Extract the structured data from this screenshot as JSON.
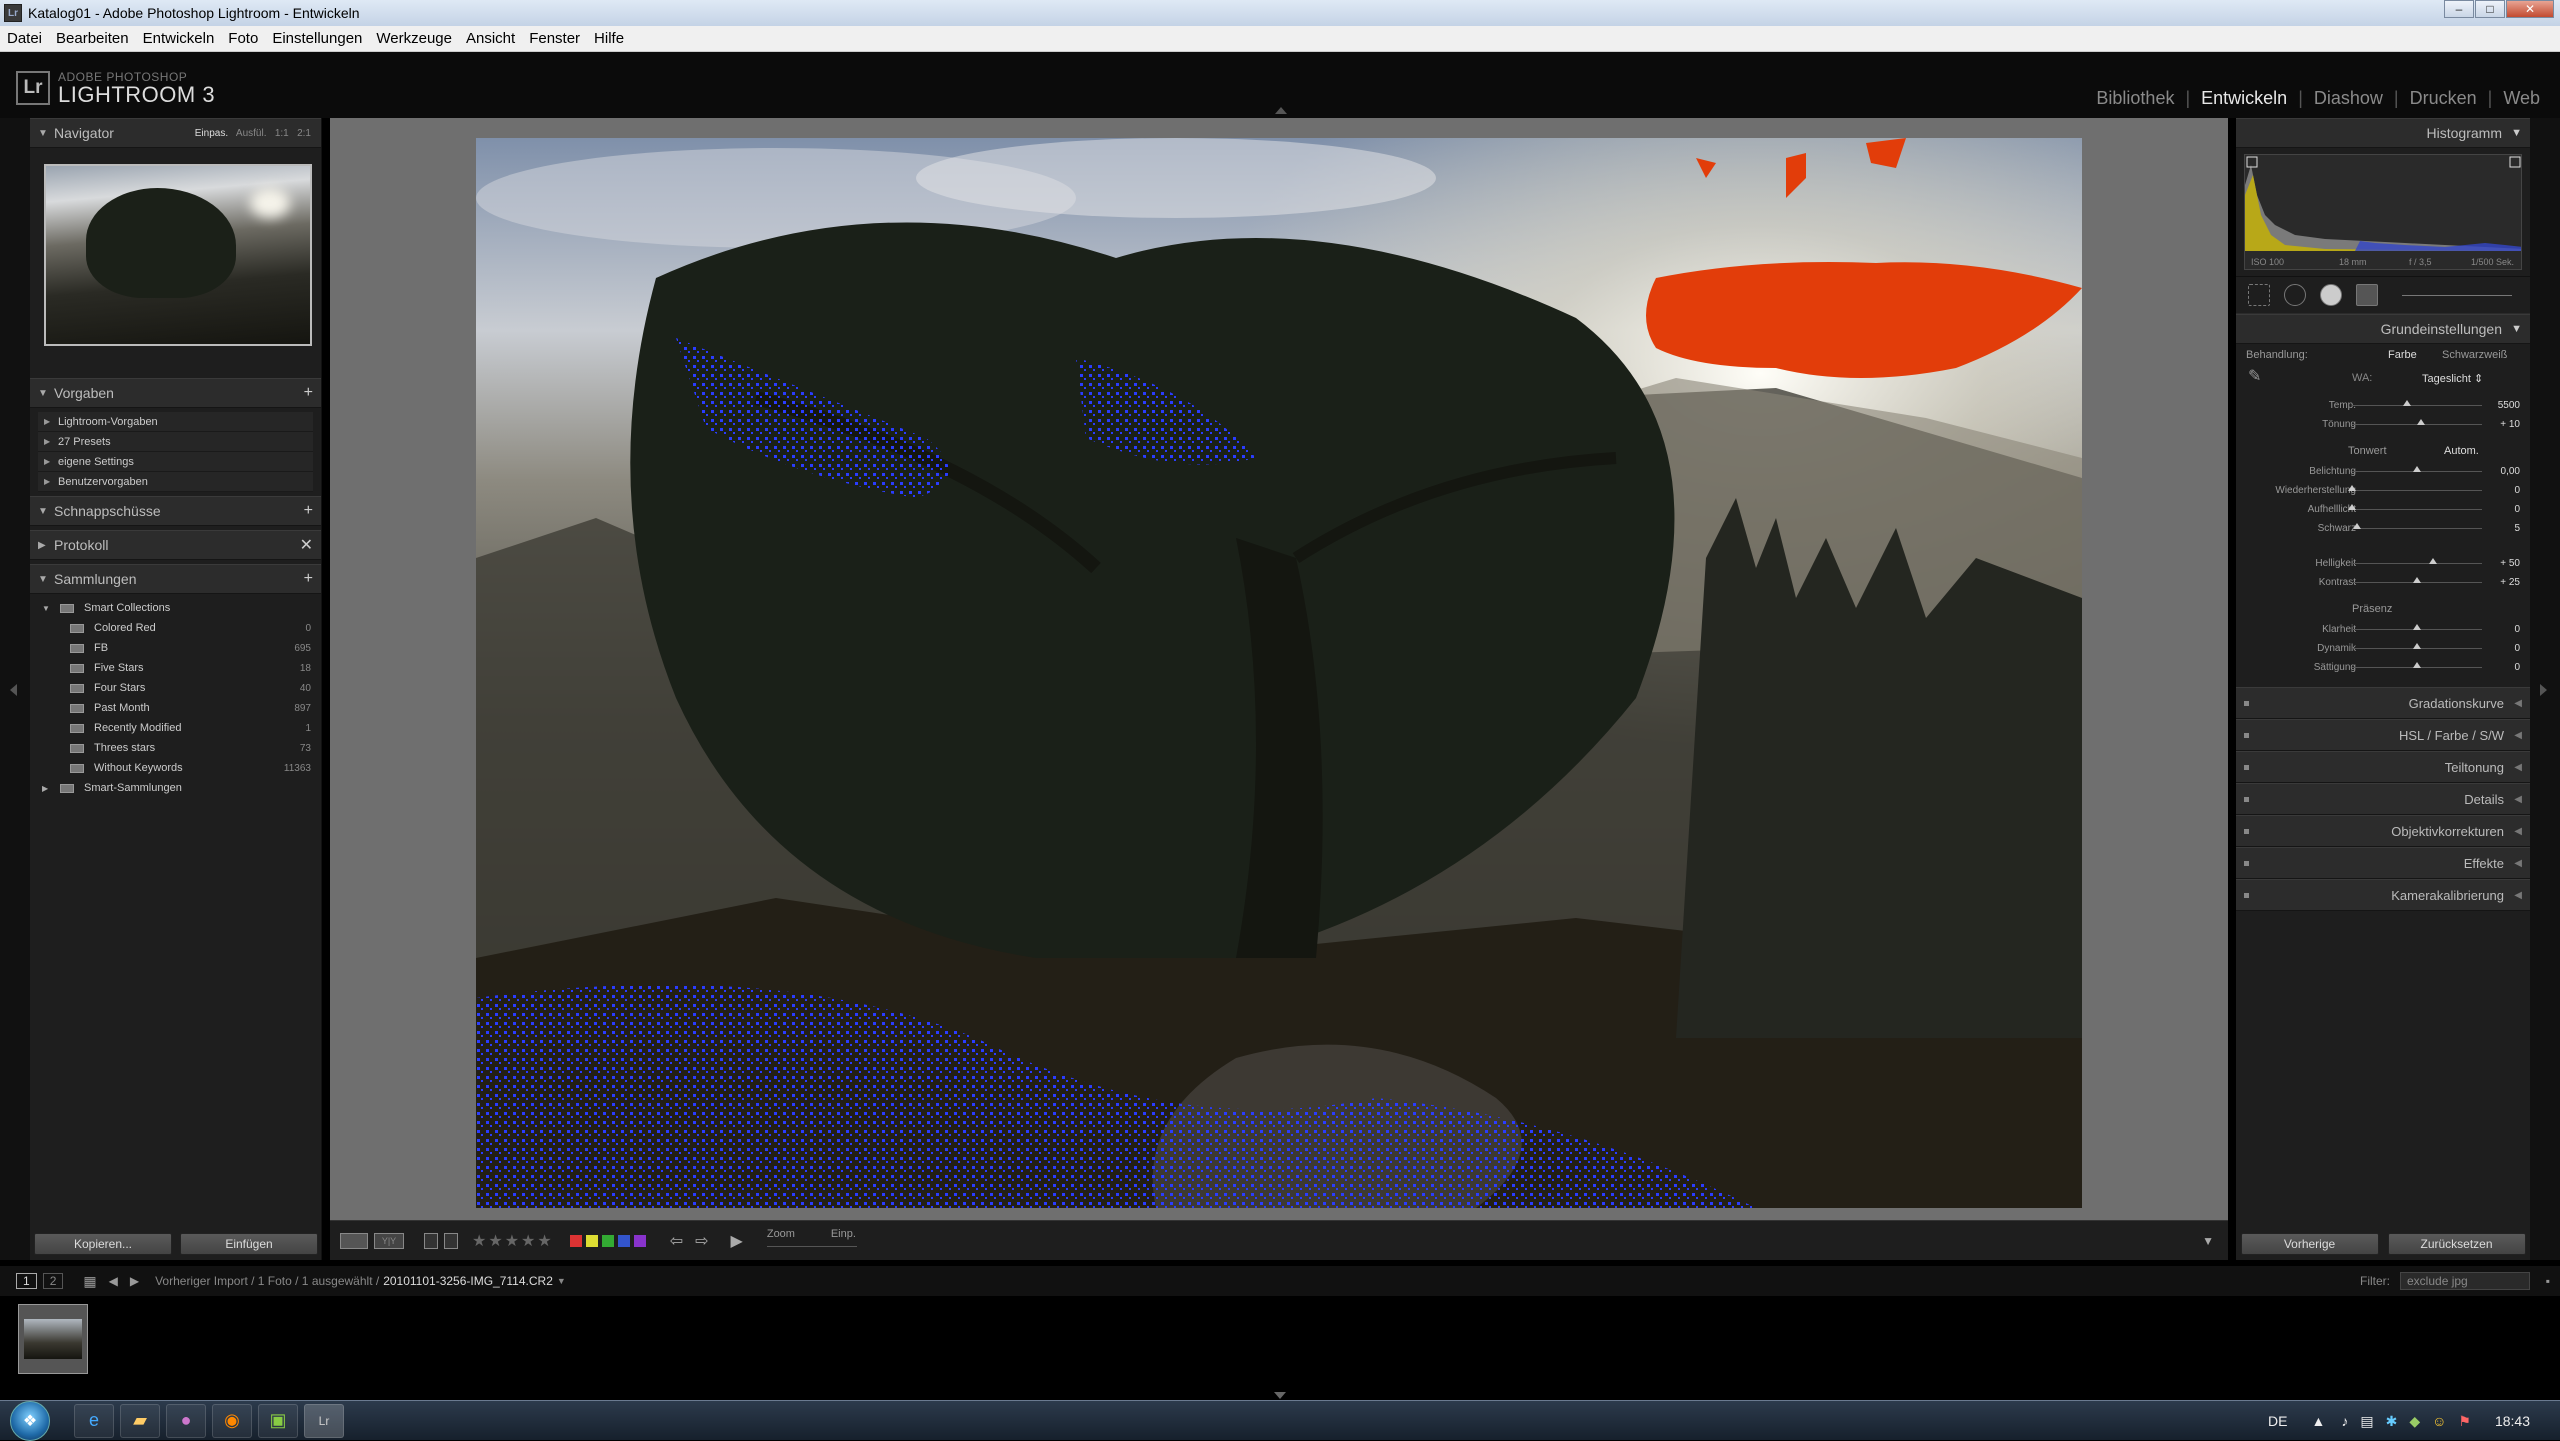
{
  "window": {
    "title": "Katalog01 - Adobe Photoshop Lightroom - Entwickeln",
    "app_icon": "Lr"
  },
  "menu": [
    "Datei",
    "Bearbeiten",
    "Entwickeln",
    "Foto",
    "Einstellungen",
    "Werkzeuge",
    "Ansicht",
    "Fenster",
    "Hilfe"
  ],
  "logo": {
    "line1": "ADOBE PHOTOSHOP",
    "line2": "LIGHTROOM 3",
    "mark": "Lr"
  },
  "modules": [
    {
      "label": "Bibliothek",
      "active": false
    },
    {
      "label": "Entwickeln",
      "active": true
    },
    {
      "label": "Diashow",
      "active": false
    },
    {
      "label": "Drucken",
      "active": false
    },
    {
      "label": "Web",
      "active": false
    }
  ],
  "navigator": {
    "title": "Navigator",
    "zoom": [
      "Einpas.",
      "Ausfül.",
      "1:1",
      "2:1"
    ]
  },
  "presets": {
    "title": "Vorgaben",
    "items": [
      "Lightroom-Vorgaben",
      "27 Presets",
      "eigene Settings",
      "Benutzervorgaben"
    ]
  },
  "snapshots": {
    "title": "Schnappschüsse"
  },
  "history": {
    "title": "Protokoll"
  },
  "collections": {
    "title": "Sammlungen",
    "parent": "Smart Collections",
    "items": [
      {
        "name": "Colored Red",
        "count": "0"
      },
      {
        "name": "FB",
        "count": "695"
      },
      {
        "name": "Five Stars",
        "count": "18"
      },
      {
        "name": "Four Stars",
        "count": "40"
      },
      {
        "name": "Past Month",
        "count": "897"
      },
      {
        "name": "Recently Modified",
        "count": "1"
      },
      {
        "name": "Threes stars",
        "count": "73"
      },
      {
        "name": "Without Keywords",
        "count": "11363"
      }
    ],
    "parent2": "Smart-Sammlungen"
  },
  "left_buttons": {
    "copy": "Kopieren...",
    "paste": "Einfügen"
  },
  "toolbar": {
    "zoom_label": "Zoom",
    "zoom_value": "Einp.",
    "stars": "★★★★★",
    "ratio_icon": "Y|Y"
  },
  "swatches": [
    "#d33",
    "#dd3",
    "#3a3",
    "#35c",
    "#83c"
  ],
  "filmbar": {
    "page1": "1",
    "page2": "2",
    "path": "Vorheriger Import / 1 Foto / 1 ausgewählt /",
    "filename": "20101101-3256-IMG_7114.CR2",
    "filter_label": "Filter:",
    "filter_value": "exclude jpg"
  },
  "histogram": {
    "title": "Histogramm",
    "iso": "ISO 100",
    "focal": "18 mm",
    "aperture": "f / 3,5",
    "shutter": "1/500 Sek."
  },
  "basic": {
    "title": "Grundeinstellungen",
    "treatment_label": "Behandlung:",
    "treatment_color": "Farbe",
    "treatment_bw": "Schwarzweiß",
    "wb_label": "WA:",
    "wb_value": "Tageslicht ⇕",
    "tone_label": "Tonwert",
    "auto_label": "Autom.",
    "presence_label": "Präsenz",
    "wb_sliders": [
      {
        "label": "Temp.",
        "value": "5500",
        "pos": 0.42
      },
      {
        "label": "Tönung",
        "value": "+ 10",
        "pos": 0.53
      }
    ],
    "tone_sliders": [
      {
        "label": "Belichtung",
        "value": "0,00",
        "pos": 0.5
      },
      {
        "label": "Wiederherstellung",
        "value": "0",
        "pos": 0.0
      },
      {
        "label": "Aufhelllicht",
        "value": "0",
        "pos": 0.0
      },
      {
        "label": "Schwarz",
        "value": "5",
        "pos": 0.04
      }
    ],
    "tone_sliders2": [
      {
        "label": "Helligkeit",
        "value": "+ 50",
        "pos": 0.62
      },
      {
        "label": "Kontrast",
        "value": "+ 25",
        "pos": 0.5
      }
    ],
    "presence_sliders": [
      {
        "label": "Klarheit",
        "value": "0",
        "pos": 0.5
      },
      {
        "label": "Dynamik",
        "value": "0",
        "pos": 0.5
      },
      {
        "label": "Sättigung",
        "value": "0",
        "pos": 0.5
      }
    ]
  },
  "right_sections": [
    {
      "name": "tone-curve",
      "label": "Gradationskurve"
    },
    {
      "name": "hsl",
      "label": "HSL  /  Farbe  /  S/W"
    },
    {
      "name": "split-toning",
      "label": "Teiltonung"
    },
    {
      "name": "detail",
      "label": "Details"
    },
    {
      "name": "lens",
      "label": "Objektivkorrekturen"
    },
    {
      "name": "effects",
      "label": "Effekte"
    },
    {
      "name": "calibration",
      "label": "Kamerakalibrierung"
    }
  ],
  "right_buttons": {
    "previous": "Vorherige",
    "reset": "Zurücksetzen"
  },
  "taskbar": {
    "lang": "DE",
    "time": "18:43"
  }
}
